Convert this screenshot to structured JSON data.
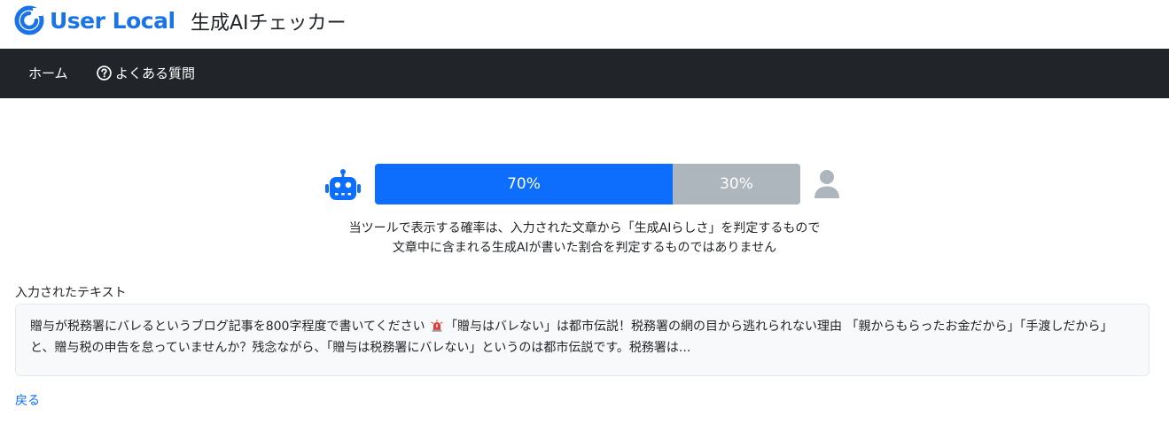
{
  "brand": {
    "logo_text": "User Local",
    "app_title": "生成AIチェッカー",
    "accent": "#1a73e8"
  },
  "nav": {
    "home": "ホーム",
    "faq": "よくある質問",
    "faq_icon": "question-circle-icon",
    "bg": "#212529"
  },
  "result": {
    "ai_percent": 70,
    "human_percent": 30,
    "ai_label": "70%",
    "human_label": "30%",
    "ai_color": "#0d6efd",
    "human_color": "#adb5bd",
    "ai_icon": "robot-icon",
    "human_icon": "person-icon"
  },
  "note": {
    "line1": "当ツールで表示する確率は、入力された文章から「生成AIらしさ」を判定するもので",
    "line2": "文章中に含まれる生成AIが書いた割合を判定するものではありません"
  },
  "input": {
    "label": "入力されたテキスト",
    "text_before": "贈与が税務署にバレるというブログ記事を800字程度で書いてください ",
    "text_icon": "rotating-light-icon",
    "text_after": "「贈与はバレない」は都市伝説！税務署の網の目から逃れられない理由 「親からもらったお金だから」「手渡しだから」と、贈与税の申告を怠っていませんか？残念ながら、「贈与は税務署にバレない」というのは都市伝説です。税務署は..."
  },
  "back_link": "戻る"
}
